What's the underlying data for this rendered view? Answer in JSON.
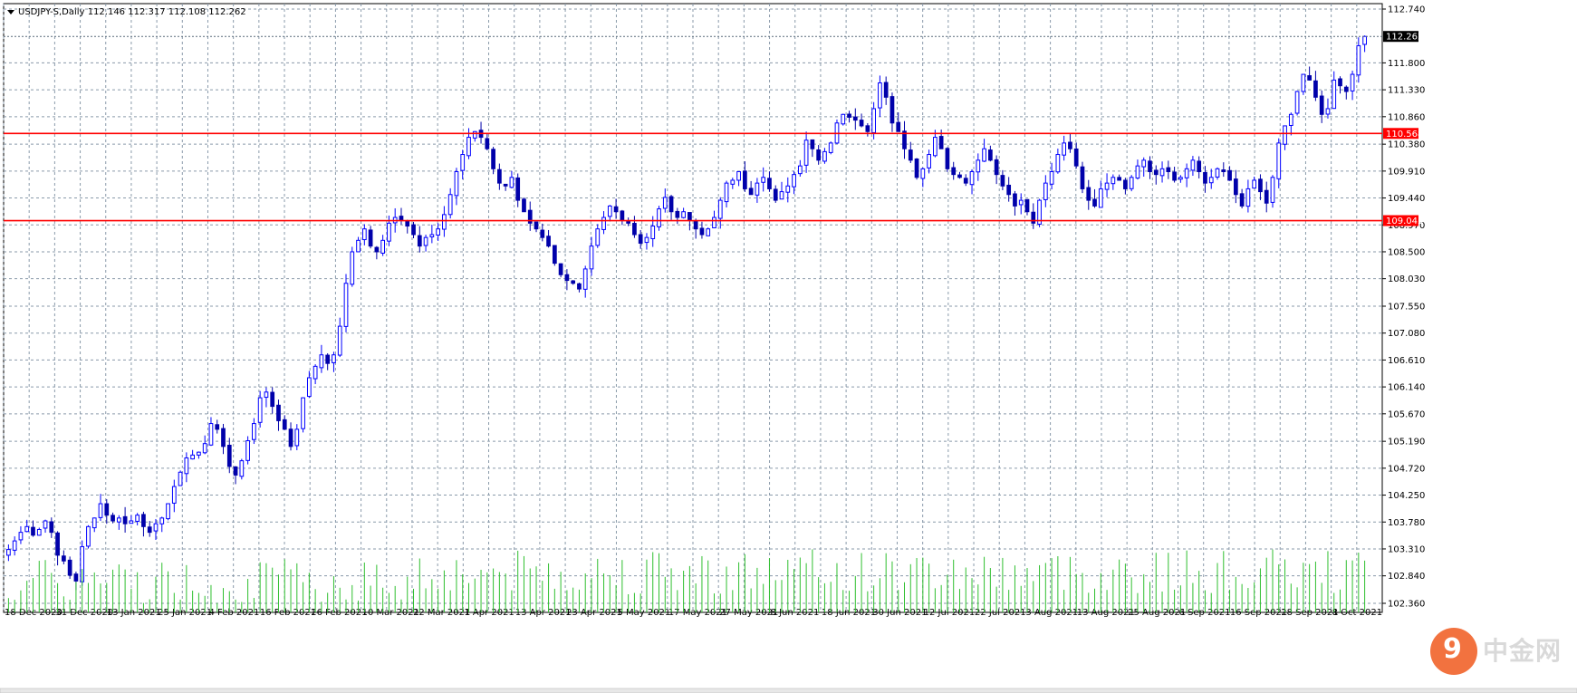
{
  "header": {
    "symbol": "USDJPY-S,Daily",
    "ohlc": "112.146 112.317 112.108 112.262"
  },
  "watermark": {
    "logo_char": "9",
    "text": "中金网"
  },
  "colors": {
    "bull": "#0000ff",
    "bear": "#0000aa",
    "volume": "#2fbf2f",
    "grid": "#8a9aaa",
    "level": "#ff0000",
    "current": "#5a6a7a"
  },
  "chart_data": {
    "type": "candlestick",
    "ylim": [
      102.36,
      112.74
    ],
    "yticks": [
      "112.740",
      "111.800",
      "111.330",
      "110.860",
      "110.380",
      "109.910",
      "109.440",
      "108.970",
      "108.500",
      "108.030",
      "107.550",
      "107.080",
      "106.610",
      "106.140",
      "105.670",
      "105.190",
      "104.720",
      "104.250",
      "103.780",
      "103.310",
      "102.840",
      "102.360"
    ],
    "xticks": [
      "18 Dec 2020",
      "31 Dec 2020",
      "13 Jan 2021",
      "25 Jan 2021",
      "4 Feb 2021",
      "16 Feb 2021",
      "26 Feb 2021",
      "10 Mar 2021",
      "22 Mar 2021",
      "1 Apr 2021",
      "13 Apr 2021",
      "23 Apr 2021",
      "5 May 2021",
      "17 May 2021",
      "27 May 2021",
      "8 Jun 2021",
      "18 Jun 2021",
      "30 Jun 2021",
      "12 Jul 2021",
      "22 Jul 2021",
      "3 Aug 2021",
      "13 Aug 2021",
      "25 Aug 2021",
      "6 Sep 2021",
      "16 Sep 2021",
      "28 Sep 2021",
      "8 Oct 2021"
    ],
    "current_price": "112.262",
    "levels": [
      {
        "value": 110.568,
        "label": "110.568"
      },
      {
        "value": 109.045,
        "label": "109.045"
      }
    ],
    "closes": [
      103.3,
      103.45,
      103.6,
      103.7,
      103.55,
      103.65,
      103.8,
      103.6,
      103.2,
      103.1,
      102.85,
      102.75,
      103.35,
      103.7,
      103.85,
      104.1,
      103.9,
      103.8,
      103.85,
      103.75,
      103.8,
      103.9,
      103.7,
      103.6,
      103.75,
      103.85,
      104.1,
      104.4,
      104.65,
      104.9,
      104.95,
      105.0,
      105.15,
      105.5,
      105.4,
      105.1,
      104.75,
      104.6,
      104.85,
      105.2,
      105.5,
      105.95,
      106.05,
      105.8,
      105.55,
      105.4,
      105.1,
      105.4,
      105.95,
      106.3,
      106.5,
      106.7,
      106.55,
      106.7,
      107.2,
      107.95,
      108.5,
      108.7,
      108.9,
      108.6,
      108.5,
      108.7,
      109.0,
      109.1,
      109.05,
      108.95,
      108.8,
      108.6,
      108.75,
      108.8,
      108.9,
      109.15,
      109.5,
      109.9,
      110.2,
      110.5,
      110.6,
      110.5,
      110.3,
      109.95,
      109.7,
      109.65,
      109.8,
      109.4,
      109.2,
      109.0,
      108.9,
      108.75,
      108.6,
      108.3,
      108.1,
      108.0,
      107.95,
      107.85,
      108.2,
      108.6,
      108.9,
      109.1,
      109.3,
      109.2,
      109.05,
      109.0,
      108.8,
      108.65,
      108.75,
      108.95,
      109.25,
      109.45,
      109.2,
      109.1,
      109.2,
      109.05,
      108.9,
      108.8,
      108.9,
      109.1,
      109.4,
      109.7,
      109.75,
      109.9,
      109.6,
      109.5,
      109.7,
      109.8,
      109.6,
      109.4,
      109.55,
      109.65,
      109.85,
      110.0,
      110.45,
      110.3,
      110.1,
      110.25,
      110.4,
      110.75,
      110.9,
      110.85,
      110.8,
      110.7,
      110.6,
      111.0,
      111.45,
      111.2,
      110.75,
      110.6,
      110.3,
      110.1,
      109.8,
      109.95,
      110.2,
      110.5,
      110.3,
      109.95,
      109.85,
      109.8,
      109.7,
      109.9,
      110.1,
      110.3,
      110.1,
      109.85,
      109.65,
      109.5,
      109.3,
      109.4,
      109.2,
      109.0,
      109.4,
      109.7,
      109.9,
      110.2,
      110.4,
      110.3,
      110.0,
      109.6,
      109.4,
      109.3,
      109.6,
      109.7,
      109.8,
      109.75,
      109.6,
      109.8,
      110.0,
      110.1,
      109.9,
      109.85,
      109.95,
      109.9,
      109.75,
      109.8,
      109.95,
      110.1,
      109.9,
      109.7,
      109.8,
      109.95,
      109.9,
      109.75,
      109.5,
      109.3,
      109.6,
      109.75,
      109.55,
      109.35,
      109.8,
      110.4,
      110.7,
      110.9,
      111.3,
      111.6,
      111.5,
      111.2,
      110.9,
      111.0,
      111.5,
      111.4,
      111.3,
      111.6,
      112.1,
      112.262
    ],
    "volume_hint": "relative tick volume bars along bottom"
  }
}
